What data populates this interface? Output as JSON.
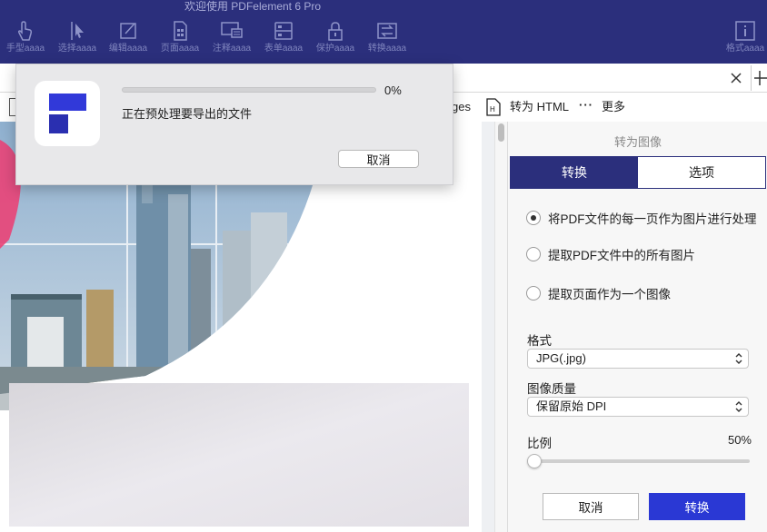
{
  "app": {
    "title": "欢迎使用 PDFelement 6 Pro"
  },
  "toolbar": {
    "items": [
      {
        "label": "手型aaaa",
        "icon": "hand-icon"
      },
      {
        "label": "选择aaaa",
        "icon": "cursor-icon"
      },
      {
        "label": "编辑aaaa",
        "icon": "edit-icon"
      },
      {
        "label": "页面aaaa",
        "icon": "page-icon"
      },
      {
        "label": "注释aaaa",
        "icon": "comment-icon"
      },
      {
        "label": "表单aaaa",
        "icon": "form-icon"
      },
      {
        "label": "保护aaaa",
        "icon": "lock-icon"
      },
      {
        "label": "转换aaaa",
        "icon": "convert-icon"
      }
    ],
    "format_label": "格式aaaa"
  },
  "subbar": {
    "partial_label": "ges",
    "to_html_label": "转为 HTML",
    "more_label": "更多"
  },
  "dialog": {
    "progress_percent": "0%",
    "progress_fraction": 0,
    "message": "正在预处理要导出的文件",
    "cancel_label": "取消"
  },
  "panel": {
    "title": "转为图像",
    "tabs": [
      {
        "label": "转换",
        "active": true
      },
      {
        "label": "选项",
        "active": false
      }
    ],
    "options": [
      {
        "label": "将PDF文件的每一页作为图片进行处理",
        "checked": true
      },
      {
        "label": "提取PDF文件中的所有图片",
        "checked": false
      },
      {
        "label": "提取页面作为一个图像",
        "checked": false
      }
    ],
    "format_label": "格式",
    "format_value": "JPG(.jpg)",
    "quality_label": "图像质量",
    "quality_value": "保留原始 DPI",
    "scale_label": "比例",
    "scale_value": "50%",
    "scale_fraction": 0,
    "cancel_label": "取消",
    "convert_label": "转换"
  },
  "colors": {
    "toolbar_bg": "#2b2f7c",
    "accent": "#2a38d4",
    "logo_blue": "#3139d9"
  }
}
